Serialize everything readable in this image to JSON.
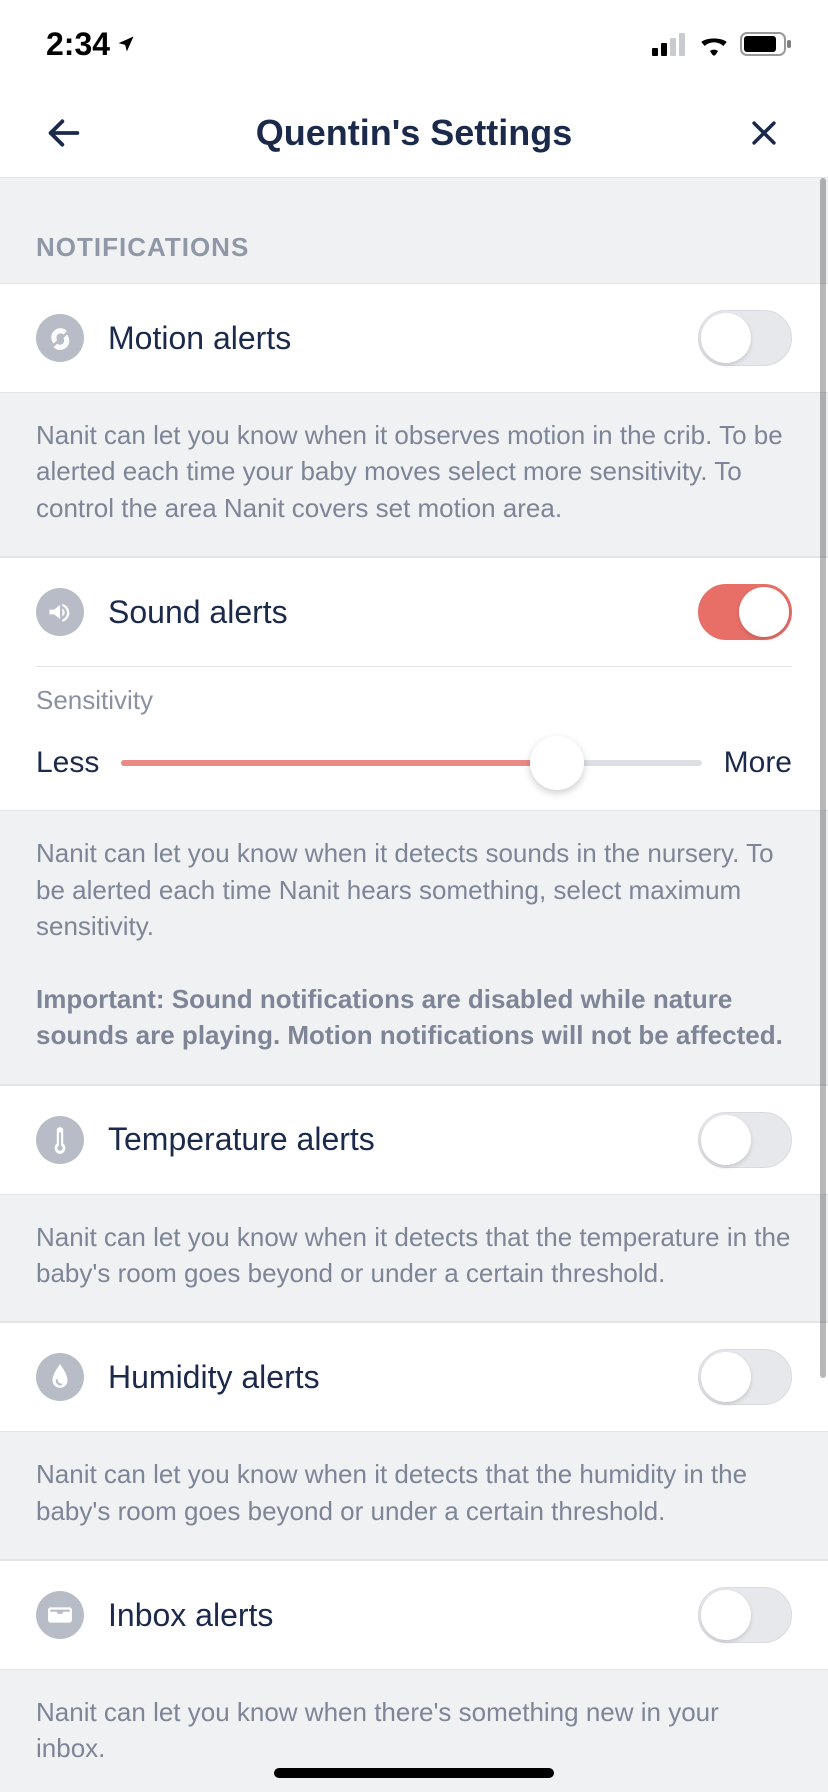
{
  "statusbar": {
    "time": "2:34",
    "location_on": true
  },
  "header": {
    "title": "Quentin's Settings"
  },
  "sections": {
    "notifications_header": "NOTIFICATIONS"
  },
  "rows": {
    "motion": {
      "label": "Motion alerts",
      "on": false,
      "desc": "Nanit can let you know when it observes motion in the crib. To be alerted each time your baby moves select more sensitivity. To control the area Nanit covers set motion area."
    },
    "sound": {
      "label": "Sound alerts",
      "on": true,
      "sensitivity_label": "Sensitivity",
      "less": "Less",
      "more": "More",
      "value_pct": 75,
      "desc1": "Nanit can let you know when it detects sounds in the nursery. To be alerted each time Nanit hears something, select maximum sensitivity.",
      "desc2": "Important: Sound notifications are disabled while nature sounds are playing. Motion notifications will not be affected."
    },
    "temperature": {
      "label": "Temperature alerts",
      "on": false,
      "desc": "Nanit can let you know when it detects that the temperature in the baby's room goes beyond or under a certain threshold."
    },
    "humidity": {
      "label": "Humidity alerts",
      "on": false,
      "desc": "Nanit can let you know when it detects that the humidity in the baby's room goes beyond or under a certain threshold."
    },
    "inbox": {
      "label": "Inbox alerts",
      "on": false,
      "desc": "Nanit can let you know when there's something new in your inbox."
    }
  }
}
